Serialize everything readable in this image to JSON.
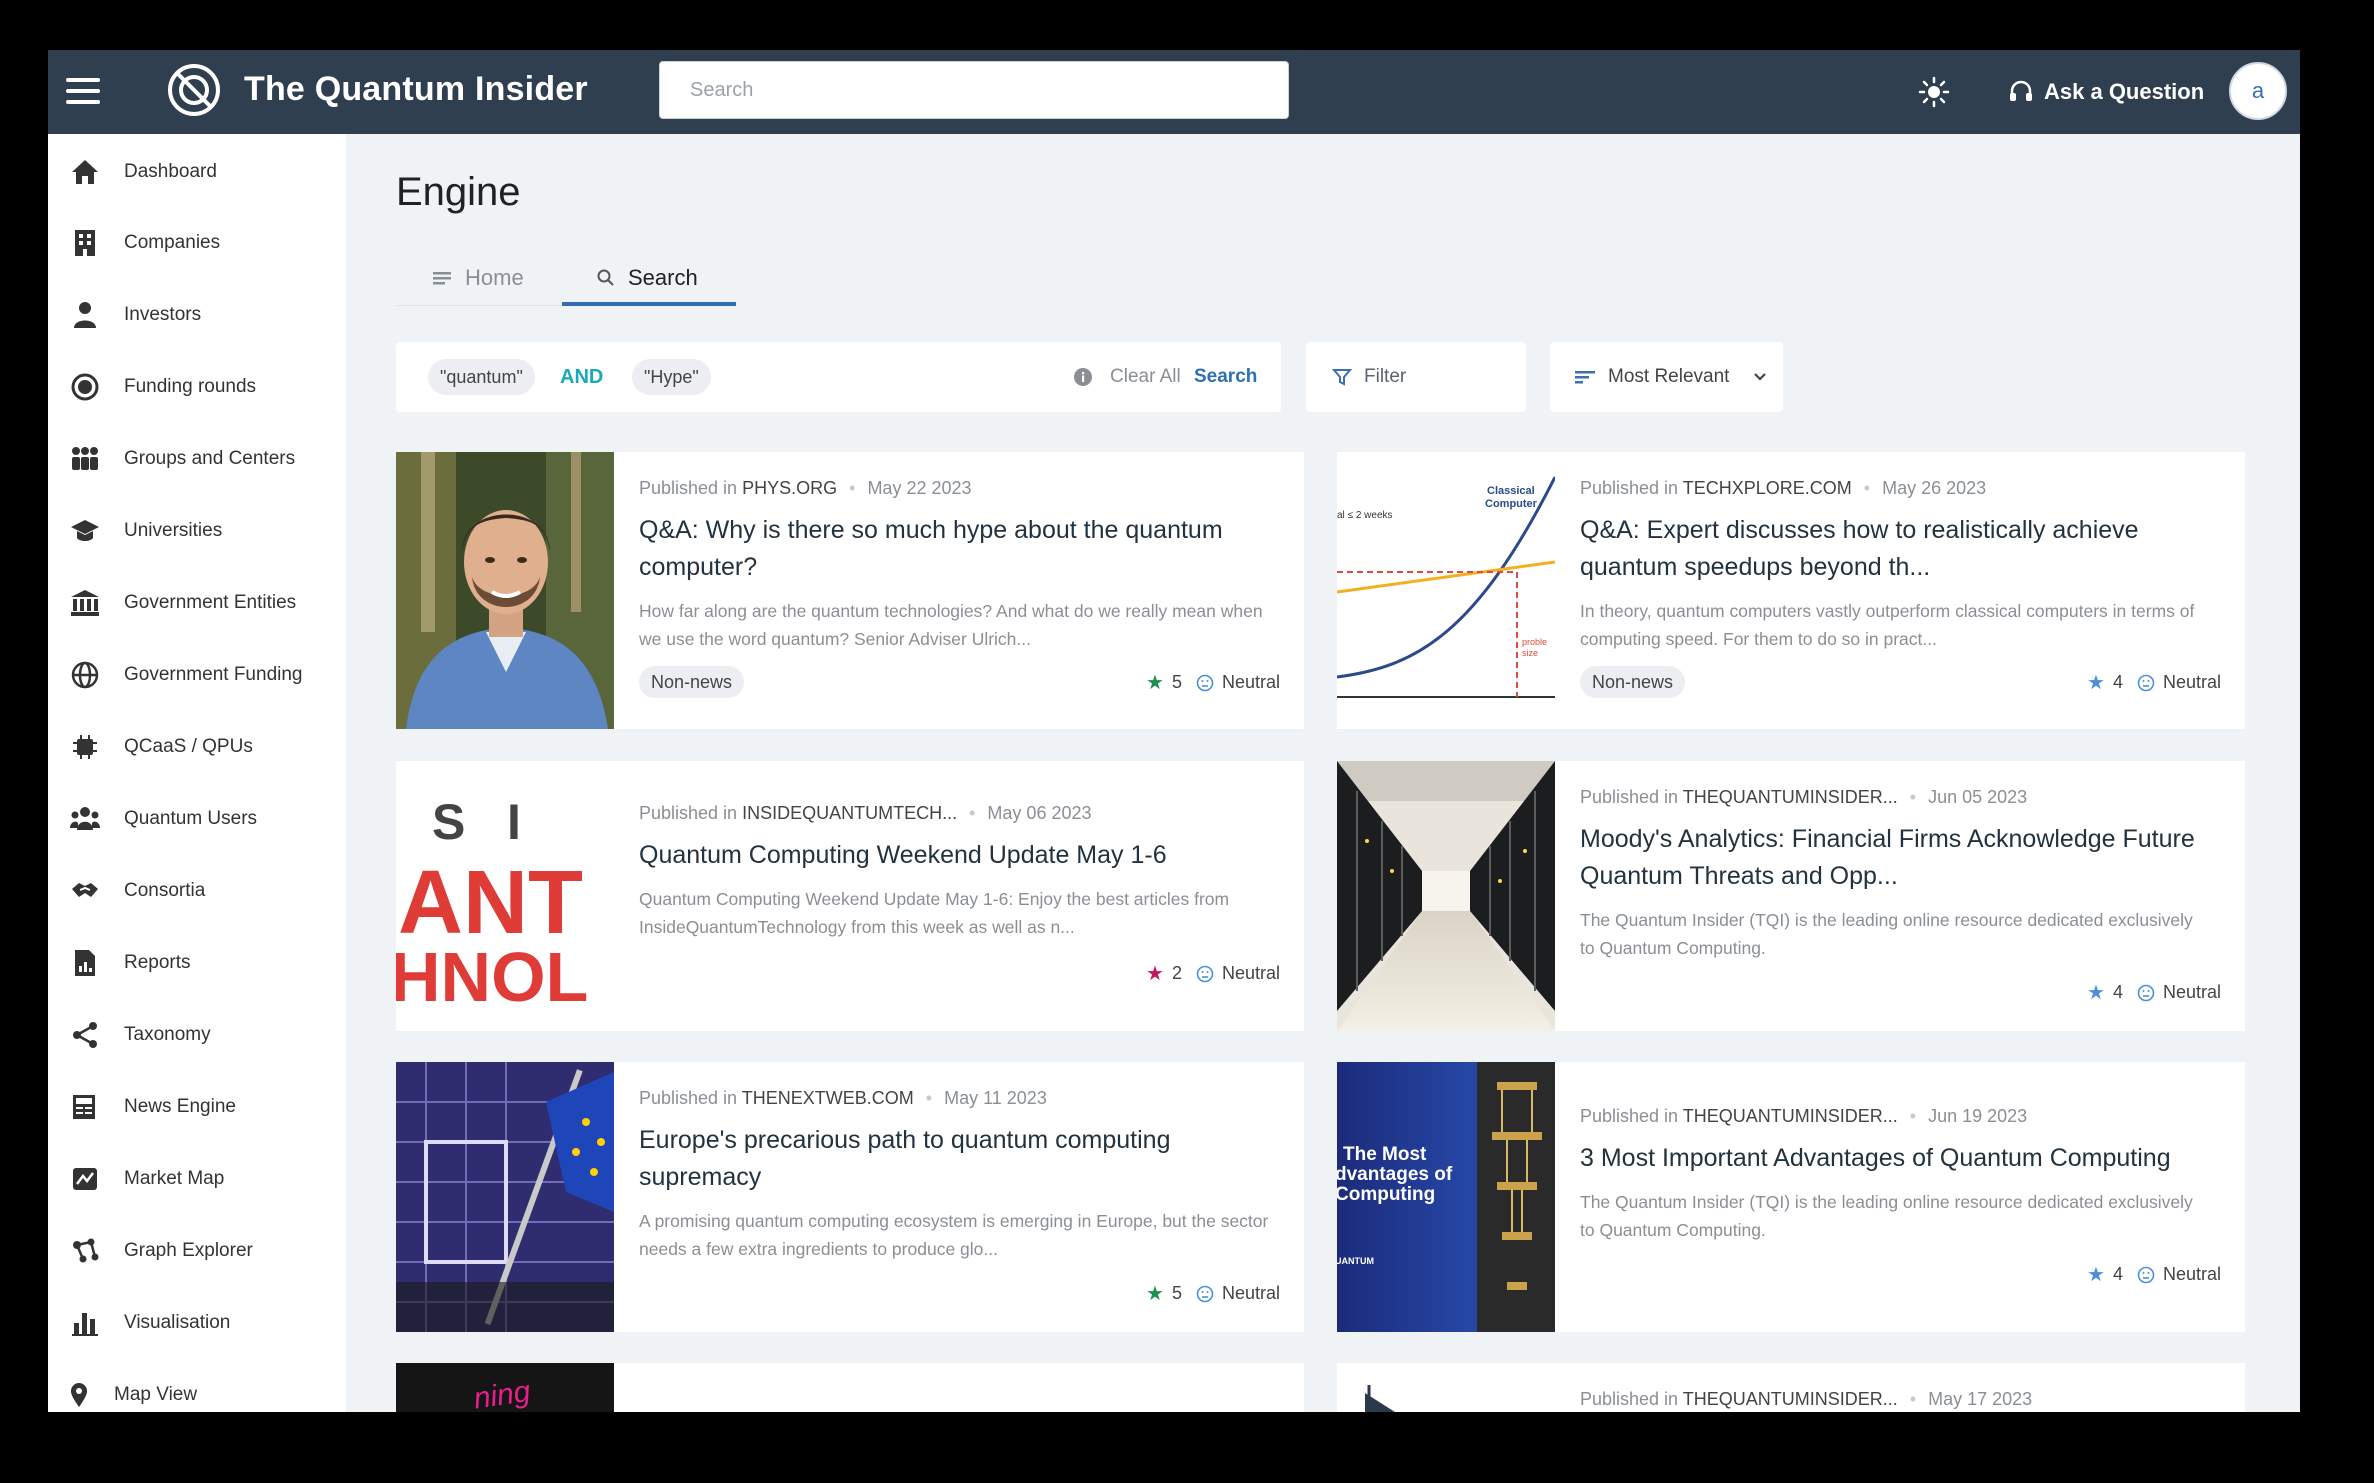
{
  "app": {
    "title": "The Quantum Insider",
    "avatar_letter": "a"
  },
  "header": {
    "search_placeholder": "Search",
    "ask_label": "Ask a Question",
    "icons": [
      "hamburger-icon",
      "logo-icon",
      "sun-icon",
      "headset-icon"
    ]
  },
  "sidebar": {
    "items": [
      {
        "label": "Dashboard",
        "icon": "home-icon"
      },
      {
        "label": "Companies",
        "icon": "building-icon"
      },
      {
        "label": "Investors",
        "icon": "person-icon"
      },
      {
        "label": "Funding rounds",
        "icon": "coin-icon"
      },
      {
        "label": "Groups and Centers",
        "icon": "group-icon"
      },
      {
        "label": "Universities",
        "icon": "graduation-cap-icon"
      },
      {
        "label": "Government Entities",
        "icon": "bank-icon"
      },
      {
        "label": "Government Funding",
        "icon": "globe-icon"
      },
      {
        "label": "QCaaS / QPUs",
        "icon": "chip-icon"
      },
      {
        "label": "Quantum Users",
        "icon": "users-icon"
      },
      {
        "label": "Consortia",
        "icon": "handshake-icon"
      },
      {
        "label": "Reports",
        "icon": "report-icon"
      },
      {
        "label": "Taxonomy",
        "icon": "share-icon"
      },
      {
        "label": "News Engine",
        "icon": "newspaper-icon"
      },
      {
        "label": "Market Map",
        "icon": "map-icon"
      },
      {
        "label": "Graph Explorer",
        "icon": "graph-icon"
      },
      {
        "label": "Visualisation",
        "icon": "bar-chart-icon"
      },
      {
        "label": "Map View",
        "icon": "pin-icon"
      }
    ]
  },
  "main": {
    "page_title": "Engine",
    "tabs": [
      {
        "label": "Home",
        "icon": "list-icon",
        "active": false
      },
      {
        "label": "Search",
        "icon": "search-icon",
        "active": true
      }
    ],
    "query": {
      "terms": [
        "\"quantum\"",
        "\"Hype\""
      ],
      "operator": "AND",
      "clear_label": "Clear All",
      "search_label": "Search"
    },
    "filter_label": "Filter",
    "sort": {
      "selected": "Most Relevant"
    },
    "published_prefix": "Published in",
    "articles": [
      {
        "source": "PHYS.ORG",
        "date": "May 22 2023",
        "title": "Q&A: Why is there so much hype about the quantum computer?",
        "description": "How far along are the quantum technologies? And what do we really mean when we use the word quantum? Senior Adviser Ulrich...",
        "tag": "Non-news",
        "rating": "5",
        "star_color": "#1f8f4e",
        "sentiment": "Neutral"
      },
      {
        "source": "TECHXPLORE.COM",
        "date": "May 26 2023",
        "title": "Q&A: Expert discusses how to realistically achieve quantum speedups beyond th...",
        "description": "In theory, quantum computers vastly outperform classical computers in terms of computing speed. For them to do so in pract...",
        "tag": "Non-news",
        "rating": "4",
        "star_color": "#4a90d9",
        "sentiment": "Neutral",
        "thumb_text": {
          "classical": "Classical",
          "computer": "Computer",
          "weeks": "al ≤ 2 weeks",
          "size1": "proble",
          "size2": "size"
        }
      },
      {
        "source": "INSIDEQUANTUMTECH...",
        "date": "May 06 2023",
        "title": "Quantum Computing Weekend Update May 1-6",
        "description": "Quantum Computing Weekend Update May 1-6: Enjoy the best articles from InsideQuantumTechnology from this week as well as n...",
        "rating": "2",
        "star_color": "#c2185b",
        "sentiment": "Neutral",
        "thumb_text": {
          "line1": "S   I",
          "line2": "ANT",
          "line3": "HNOL"
        }
      },
      {
        "source": "THEQUANTUMINSIDER...",
        "date": "Jun 05 2023",
        "title": "Moody's Analytics: Financial Firms Acknowledge Future Quantum Threats and Opp...",
        "description": "The Quantum Insider (TQI) is the leading online resource dedicated exclusively to Quantum Computing.",
        "rating": "4",
        "star_color": "#4a90d9",
        "sentiment": "Neutral"
      },
      {
        "source": "THENEXTWEB.COM",
        "date": "May 11 2023",
        "title": "Europe's precarious path to quantum computing supremacy",
        "description": "A promising quantum computing ecosystem is emerging in Europe, but the sector needs a few extra ingredients to produce glo...",
        "rating": "5",
        "star_color": "#1f8f4e",
        "sentiment": "Neutral"
      },
      {
        "source": "THEQUANTUMINSIDER...",
        "date": "Jun 19 2023",
        "title": "3 Most Important Advantages of Quantum Computing",
        "description": "The Quantum Insider (TQI) is the leading online resource dedicated exclusively to Quantum Computing.",
        "rating": "4",
        "star_color": "#4a90d9",
        "sentiment": "Neutral",
        "thumb_text": {
          "line1": "The Most",
          "line2": "dvantages of",
          "line3": "Computing",
          "brand": "UANTUM"
        }
      },
      {
        "thumb_text": {
          "word": "ning"
        }
      },
      {
        "source": "THEQUANTUMINSIDER...",
        "date": "May 17 2023"
      }
    ]
  }
}
